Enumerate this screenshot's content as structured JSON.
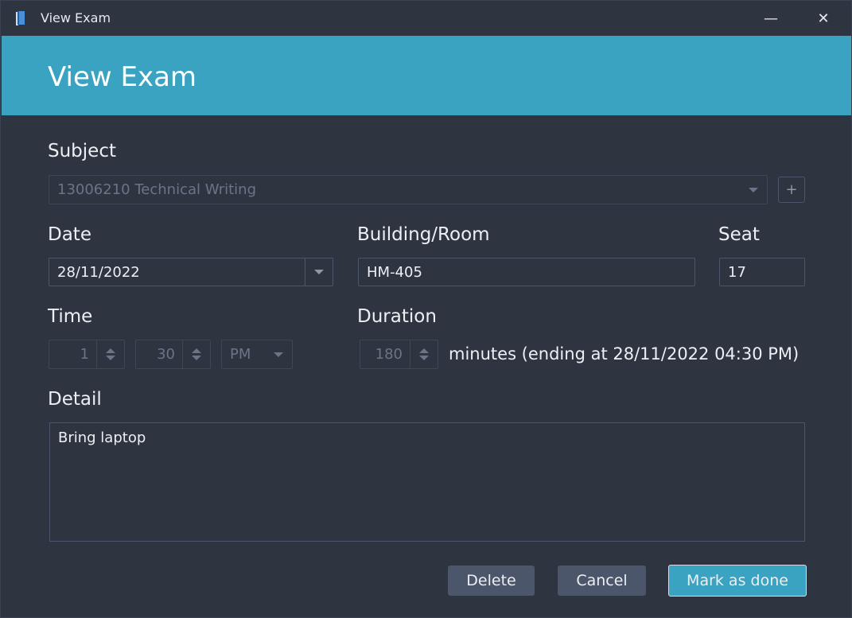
{
  "window": {
    "title": "View Exam",
    "minimize_glyph": "—",
    "close_glyph": "✕"
  },
  "header": {
    "title": "View Exam"
  },
  "subject": {
    "label": "Subject",
    "value": "13006210 Technical Writing",
    "add_glyph": "+"
  },
  "date": {
    "label": "Date",
    "value": "28/11/2022"
  },
  "room": {
    "label": "Building/Room",
    "value": "HM-405"
  },
  "seat": {
    "label": "Seat",
    "value": "17"
  },
  "time": {
    "label": "Time",
    "hour": "1",
    "minute": "30",
    "ampm": "PM"
  },
  "duration": {
    "label": "Duration",
    "value": "180",
    "suffix": "minutes (ending at 28/11/2022 04:30 PM)"
  },
  "detail": {
    "label": "Detail",
    "value": "Bring laptop"
  },
  "buttons": {
    "delete": "Delete",
    "cancel": "Cancel",
    "done": "Mark as done"
  },
  "colors": {
    "accent": "#3aa3c1",
    "background": "#2e3440",
    "button": "#4c566a"
  }
}
